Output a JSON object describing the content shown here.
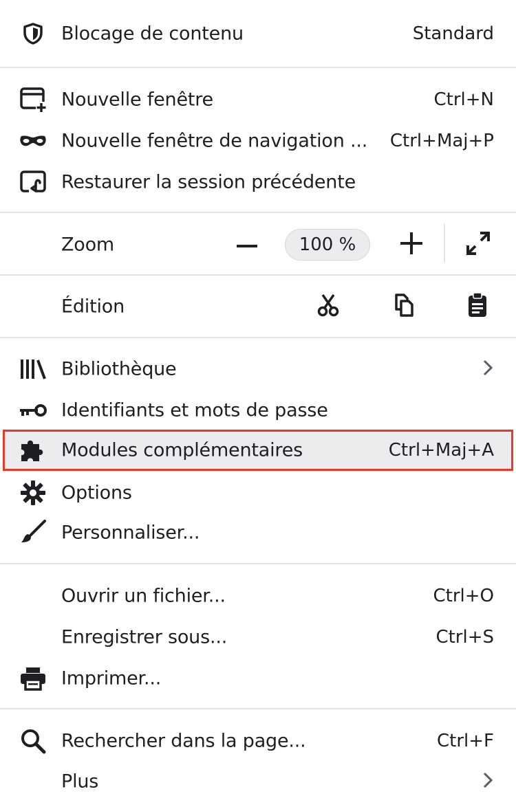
{
  "accent": {
    "highlight_border": "#e53a23",
    "highlight_bg": "#ececee"
  },
  "content_blocking": {
    "label": "Blocage de contenu",
    "value": "Standard",
    "icon": "shield-icon"
  },
  "window_section": [
    {
      "label": "Nouvelle fenêtre",
      "shortcut": "Ctrl+N",
      "icon": "new-window-icon"
    },
    {
      "label": "Nouvelle fenêtre de navigation ...",
      "shortcut": "Ctrl+Maj+P",
      "icon": "private-mask-icon"
    },
    {
      "label": "Restaurer la session précédente",
      "shortcut": "",
      "icon": "restore-session-icon"
    }
  ],
  "zoom": {
    "label": "Zoom",
    "value": "100 %",
    "minus_icon": "minus-icon",
    "plus_icon": "plus-icon",
    "fullscreen_icon": "fullscreen-icon"
  },
  "edit": {
    "label": "Édition",
    "cut_icon": "scissors-icon",
    "copy_icon": "copy-icon",
    "paste_icon": "clipboard-icon"
  },
  "tools_section": [
    {
      "label": "Bibliothèque",
      "shortcut": "",
      "icon": "library-icon",
      "submenu": true
    },
    {
      "label": "Identifiants et mots de passe",
      "shortcut": "",
      "icon": "key-icon"
    },
    {
      "label": "Modules complémentaires",
      "shortcut": "Ctrl+Maj+A",
      "icon": "puzzle-icon",
      "highlighted": true
    },
    {
      "label": "Options",
      "shortcut": "",
      "icon": "gear-icon"
    },
    {
      "label": "Personnaliser...",
      "shortcut": "",
      "icon": "paintbrush-icon"
    }
  ],
  "file_section": [
    {
      "label": "Ouvrir un fichier...",
      "shortcut": "Ctrl+O"
    },
    {
      "label": "Enregistrer sous...",
      "shortcut": "Ctrl+S"
    },
    {
      "label": "Imprimer...",
      "shortcut": "",
      "icon": "printer-icon"
    }
  ],
  "find_section": [
    {
      "label": "Rechercher dans la page...",
      "shortcut": "Ctrl+F",
      "icon": "search-icon"
    },
    {
      "label": "Plus",
      "shortcut": "",
      "submenu": true
    }
  ]
}
